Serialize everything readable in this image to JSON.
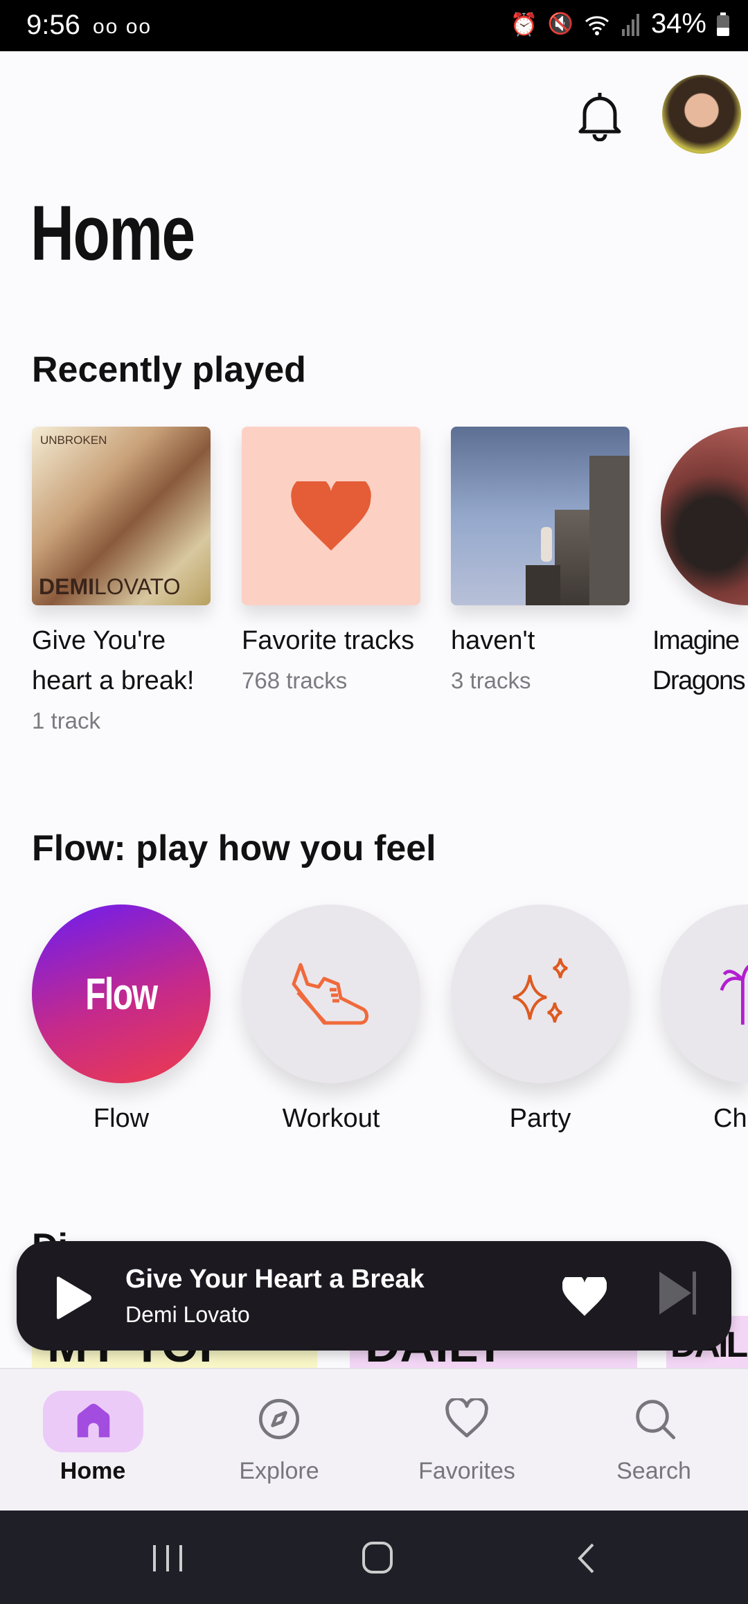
{
  "status_bar": {
    "time": "9:56",
    "voicemail": "oo oo",
    "battery": "34%"
  },
  "header": {
    "title": "Home",
    "notification_icon": "bell-icon",
    "avatar": "user-avatar"
  },
  "recently_played": {
    "heading": "Recently played",
    "items": [
      {
        "title_line1": "Give You're",
        "title_line2": "heart a break!",
        "subtitle": "1 track",
        "art_logo_top": "UNBROKEN",
        "art_logo_bottom_bold": "DEMI",
        "art_logo_bottom_light": "LOVATO"
      },
      {
        "title_line1": "Favorite tracks",
        "subtitle": "768 tracks",
        "color": "#fdd0c4",
        "heart_color": "#e55d37"
      },
      {
        "title_line1": "haven't",
        "subtitle": "3 tracks"
      },
      {
        "title_line1": "Imagine",
        "title_line2": "Dragons"
      }
    ]
  },
  "flow": {
    "heading": "Flow: play how you feel",
    "items": [
      {
        "label": "Flow",
        "badge": "Flow"
      },
      {
        "label": "Workout",
        "icon": "sneaker-icon"
      },
      {
        "label": "Party",
        "icon": "sparkles-icon"
      },
      {
        "label": "Ch",
        "icon": "palm-tree-icon"
      }
    ]
  },
  "next_section": {
    "heading": "Di",
    "mixes": [
      "MY TOP SUMMER",
      "DAILY",
      "DAIL"
    ]
  },
  "player": {
    "title": "Give Your Heart a Break",
    "artist": "Demi Lovato"
  },
  "bottom_nav": {
    "items": [
      {
        "label": "Home",
        "active": true
      },
      {
        "label": "Explore"
      },
      {
        "label": "Favorites"
      },
      {
        "label": "Search"
      }
    ],
    "accent": "#a24ce0"
  }
}
